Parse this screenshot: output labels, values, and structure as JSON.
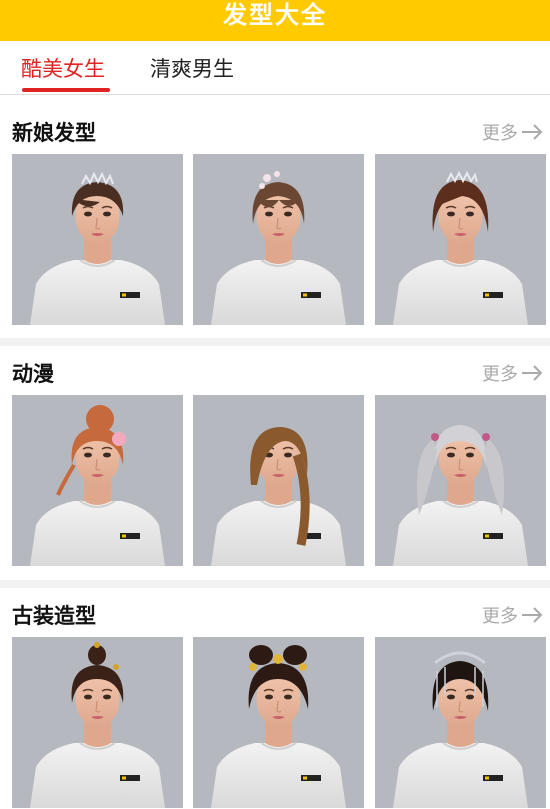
{
  "header": {
    "title": "发型大全"
  },
  "tabs": [
    {
      "label": "酷美女生",
      "active": true
    },
    {
      "label": "清爽男生",
      "active": false
    }
  ],
  "sections": [
    {
      "title": "新娘发型",
      "more": "更多"
    },
    {
      "title": "动漫",
      "more": "更多"
    },
    {
      "title": "古装造型",
      "more": "更多"
    }
  ],
  "colors": {
    "header_bg": "#FFCA00",
    "accent_red": "#E02424",
    "thumb_bg": "#B5B9BF"
  },
  "icons": {
    "more": "arrow-right-icon"
  }
}
